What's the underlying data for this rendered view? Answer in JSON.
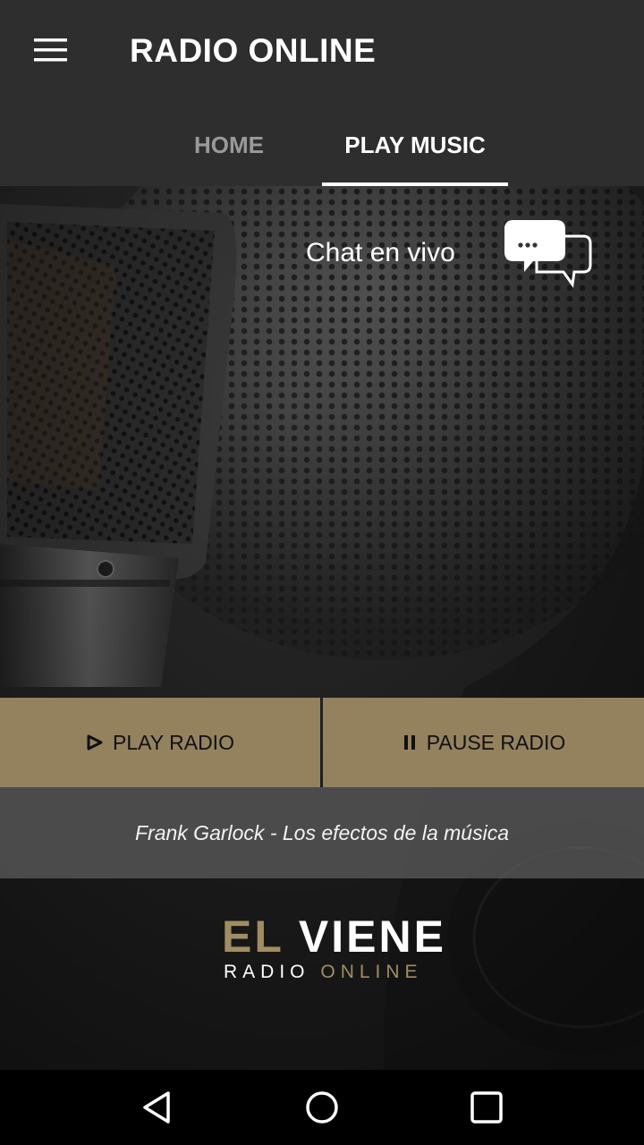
{
  "appbar": {
    "title": "RADIO ONLINE",
    "menu_icon": "hamburger-menu-icon"
  },
  "tabs": [
    {
      "label": "HOME",
      "selected": false
    },
    {
      "label": "PLAY MUSIC",
      "selected": true
    }
  ],
  "chat": {
    "label": "Chat en vivo",
    "icon": "chat-bubbles-icon"
  },
  "controls": {
    "play_label": "PLAY RADIO",
    "play_icon": "play-icon",
    "pause_label": "PAUSE RADIO",
    "pause_icon": "pause-icon"
  },
  "now_playing": "Frank Garlock - Los efectos de la música",
  "logo": {
    "word1": "EL",
    "word2": "VIENE",
    "word3": "RADIO",
    "word4": "ONLINE"
  },
  "navbar": {
    "back_icon": "back-triangle-icon",
    "home_icon": "home-circle-icon",
    "recents_icon": "recents-square-icon"
  },
  "colors": {
    "appbar": "#2e2e2e",
    "accent_gold": "#94825f",
    "tab_inactive": "#9a9a9a",
    "tab_active": "#ffffff"
  }
}
